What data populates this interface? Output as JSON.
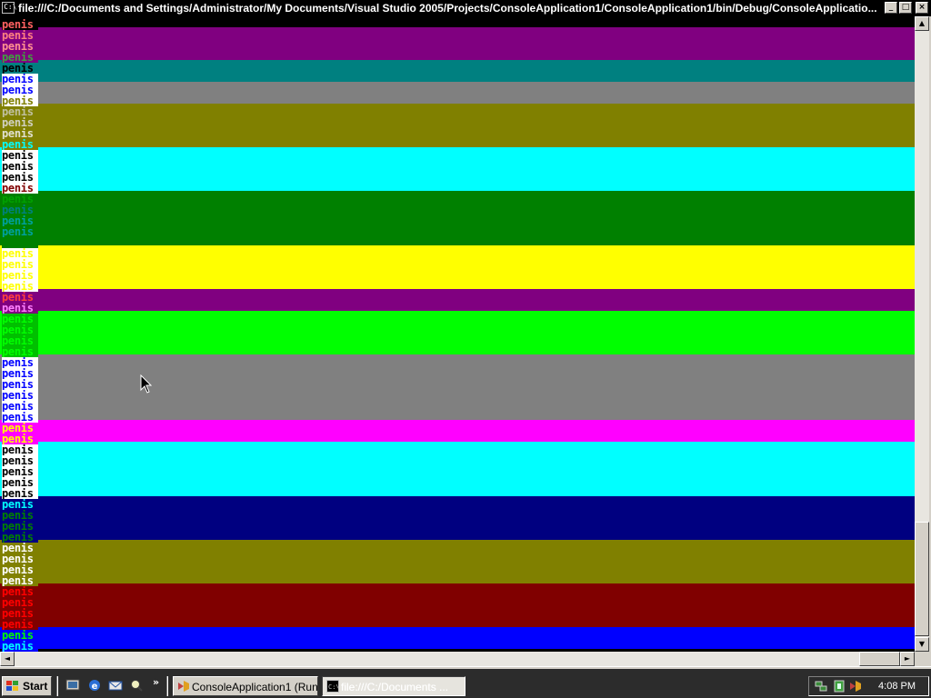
{
  "window": {
    "title": "file:///C:/Documents and Settings/Administrator/My Documents/Visual Studio 2005/Projects/ConsoleApplication1/ConsoleApplication1/bin/Debug/ConsoleApplicatio...",
    "minimize_label": "_",
    "maximize_label": "□",
    "close_label": "×"
  },
  "console": {
    "bands": [
      {
        "bg": "#000000",
        "rows": 1
      },
      {
        "bg": "#800080",
        "rows": 3
      },
      {
        "bg": "#008080",
        "rows": 2
      },
      {
        "bg": "#808080",
        "rows": 2
      },
      {
        "bg": "#808000",
        "rows": 4
      },
      {
        "bg": "#00ffff",
        "rows": 4
      },
      {
        "bg": "#008000",
        "rows": 5
      },
      {
        "bg": "#ffff00",
        "rows": 4
      },
      {
        "bg": "#800080",
        "rows": 2
      },
      {
        "bg": "#00ff00",
        "rows": 4
      },
      {
        "bg": "#808080",
        "rows": 6
      },
      {
        "bg": "#ff00ff",
        "rows": 2
      },
      {
        "bg": "#00ffff",
        "rows": 5
      },
      {
        "bg": "#000080",
        "rows": 4
      },
      {
        "bg": "#808000",
        "rows": 4
      },
      {
        "bg": "#800000",
        "rows": 4
      },
      {
        "bg": "#0000ff",
        "rows": 2
      }
    ],
    "lines": [
      {
        "text": "penis",
        "fg": "#ff6060",
        "bg": "#000000"
      },
      {
        "text": "penis",
        "fg": "#ff8080",
        "bg": "#800080"
      },
      {
        "text": "penis",
        "fg": "#ff9090",
        "bg": "#800080"
      },
      {
        "text": "penis",
        "fg": "#40a040",
        "bg": "#800080"
      },
      {
        "text": "penis",
        "fg": "#000000",
        "bg": "#008080"
      },
      {
        "text": "penis",
        "fg": "#0000ff",
        "bg": "#ffffff"
      },
      {
        "text": "penis",
        "fg": "#0000ff",
        "bg": "#ffffff"
      },
      {
        "text": "penis",
        "fg": "#808000",
        "bg": "#ffffff"
      },
      {
        "text": "penis",
        "fg": "#c0c0a0",
        "bg": "#808000"
      },
      {
        "text": "penis",
        "fg": "#d0d0c0",
        "bg": "#808000"
      },
      {
        "text": "penis",
        "fg": "#e0e0d0",
        "bg": "#808000"
      },
      {
        "text": "penis",
        "fg": "#00ffff",
        "bg": "#808000"
      },
      {
        "text": "penis",
        "fg": "#000000",
        "bg": "#ffffff"
      },
      {
        "text": "penis",
        "fg": "#000000",
        "bg": "#ffffff"
      },
      {
        "text": "penis",
        "fg": "#000000",
        "bg": "#ffffff"
      },
      {
        "text": "penis",
        "fg": "#800000",
        "bg": "#ffffff"
      },
      {
        "text": "penis",
        "fg": "#00a000",
        "bg": "#008000"
      },
      {
        "text": "penis",
        "fg": "#008080",
        "bg": "#008000"
      },
      {
        "text": "penis",
        "fg": "#00a0a0",
        "bg": "#008000"
      },
      {
        "text": "penis",
        "fg": "#00a0a0",
        "bg": "#008000"
      },
      {
        "text": "penis",
        "fg": "#008000",
        "bg": "#008000"
      },
      {
        "text": "penis",
        "fg": "#ffff00",
        "bg": "#ffffff"
      },
      {
        "text": "penis",
        "fg": "#ffff00",
        "bg": "#ffffff"
      },
      {
        "text": "penis",
        "fg": "#ffff00",
        "bg": "#ffffff"
      },
      {
        "text": "penis",
        "fg": "#ffff00",
        "bg": "#ffffff"
      },
      {
        "text": "penis",
        "fg": "#ff4040",
        "bg": "#800080"
      },
      {
        "text": "penis",
        "fg": "#ff80ff",
        "bg": "#800080"
      },
      {
        "text": "penis",
        "fg": "#00ff00",
        "bg": "#00c000"
      },
      {
        "text": "penis",
        "fg": "#00ff00",
        "bg": "#00c000"
      },
      {
        "text": "penis",
        "fg": "#00ff00",
        "bg": "#00c000"
      },
      {
        "text": "penis",
        "fg": "#00ff00",
        "bg": "#00c000"
      },
      {
        "text": "penis",
        "fg": "#0000ff",
        "bg": "#ffffff"
      },
      {
        "text": "penis",
        "fg": "#0000ff",
        "bg": "#ffffff"
      },
      {
        "text": "penis",
        "fg": "#0000ff",
        "bg": "#ffffff"
      },
      {
        "text": "penis",
        "fg": "#0000ff",
        "bg": "#ffffff"
      },
      {
        "text": "penis",
        "fg": "#0000ff",
        "bg": "#ffffff"
      },
      {
        "text": "penis",
        "fg": "#0000ff",
        "bg": "#ffffff"
      },
      {
        "text": "penis",
        "fg": "#ffff00",
        "bg": "#ff00ff"
      },
      {
        "text": "penis",
        "fg": "#ffff00",
        "bg": "#ff00ff"
      },
      {
        "text": "penis",
        "fg": "#000000",
        "bg": "#ffffff"
      },
      {
        "text": "penis",
        "fg": "#000000",
        "bg": "#ffffff"
      },
      {
        "text": "penis",
        "fg": "#000000",
        "bg": "#ffffff"
      },
      {
        "text": "penis",
        "fg": "#000000",
        "bg": "#ffffff"
      },
      {
        "text": "penis",
        "fg": "#000000",
        "bg": "#ffffff"
      },
      {
        "text": "penis",
        "fg": "#00ffff",
        "bg": "#000080"
      },
      {
        "text": "penis",
        "fg": "#008000",
        "bg": "#000080"
      },
      {
        "text": "penis",
        "fg": "#008000",
        "bg": "#000080"
      },
      {
        "text": "penis",
        "fg": "#008000",
        "bg": "#000080"
      },
      {
        "text": "penis",
        "fg": "#ffffff",
        "bg": "#808000"
      },
      {
        "text": "penis",
        "fg": "#ffffff",
        "bg": "#808000"
      },
      {
        "text": "penis",
        "fg": "#ffffff",
        "bg": "#808000"
      },
      {
        "text": "penis",
        "fg": "#ffffff",
        "bg": "#808000"
      },
      {
        "text": "penis",
        "fg": "#ff0000",
        "bg": "#800000"
      },
      {
        "text": "penis",
        "fg": "#ff0000",
        "bg": "#800000"
      },
      {
        "text": "penis",
        "fg": "#ff0000",
        "bg": "#800000"
      },
      {
        "text": "penis",
        "fg": "#ff0000",
        "bg": "#800000"
      },
      {
        "text": "penis",
        "fg": "#00ff00",
        "bg": "#0000ff"
      },
      {
        "text": "penis",
        "fg": "#00ffff",
        "bg": "#0000ff"
      },
      {
        "text": "penis",
        "fg": "#00ff00",
        "bg": "#0000ff"
      }
    ]
  },
  "scrollbars": {
    "up_arrow": "▲",
    "down_arrow": "▼",
    "left_arrow": "◄",
    "right_arrow": "►"
  },
  "taskbar": {
    "start_label": "Start",
    "overflow_label": "»",
    "tasks": [
      {
        "label": "ConsoleApplication1 (Run...",
        "icon": "visual-studio-icon",
        "active": false
      },
      {
        "label": "file:///C:/Documents ...",
        "icon": "console-icon",
        "active": true
      }
    ],
    "clock": "4:08 PM",
    "quick_launch": [
      "show-desktop-icon",
      "internet-explorer-icon",
      "outlook-express-icon",
      "search-icon"
    ],
    "tray_icons": [
      "network-icon",
      "volume-icon",
      "visual-studio-tray-icon"
    ]
  },
  "colors": {
    "title_bg": "#000000",
    "title_fg": "#ffffff",
    "taskbar_bg": "#2c2c2c",
    "chrome": "#d4d0c8"
  }
}
